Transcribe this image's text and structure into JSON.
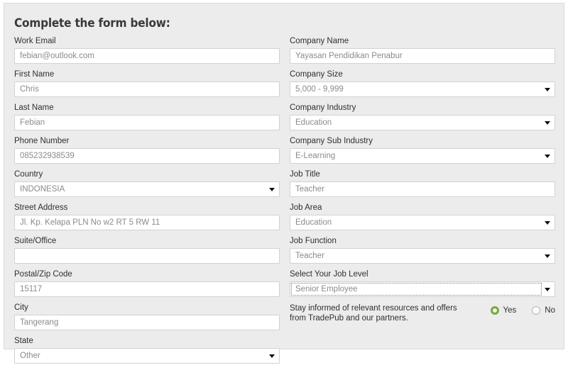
{
  "form": {
    "title": "Complete the form below:",
    "left_fields": [
      {
        "label": "Work Email",
        "value": "febian@outlook.com",
        "type": "text",
        "name": "work-email"
      },
      {
        "label": "First Name",
        "value": "Chris",
        "type": "text",
        "name": "first-name"
      },
      {
        "label": "Last Name",
        "value": "Febian",
        "type": "text",
        "name": "last-name"
      },
      {
        "label": "Phone Number",
        "value": "085232938539",
        "type": "text",
        "name": "phone-number"
      },
      {
        "label": "Country",
        "value": "INDONESIA",
        "type": "select",
        "name": "country"
      },
      {
        "label": "Street Address",
        "value": "Jl. Kp. Kelapa PLN No w2 RT 5 RW 11",
        "type": "text",
        "name": "street-address"
      },
      {
        "label": "Suite/Office",
        "value": "",
        "type": "text",
        "name": "suite-office"
      },
      {
        "label": "Postal/Zip Code",
        "value": "15117",
        "type": "text",
        "name": "postal-zip-code"
      },
      {
        "label": "City",
        "value": "Tangerang",
        "type": "text",
        "name": "city"
      },
      {
        "label": "State",
        "value": "Other",
        "type": "select",
        "name": "state"
      }
    ],
    "right_fields": [
      {
        "label": "Company Name",
        "value": "Yayasan Pendidikan Penabur",
        "type": "text",
        "name": "company-name"
      },
      {
        "label": "Company Size",
        "value": "5,000 - 9,999",
        "type": "select",
        "name": "company-size"
      },
      {
        "label": "Company Industry",
        "value": "Education",
        "type": "select",
        "name": "company-industry"
      },
      {
        "label": "Company Sub Industry",
        "value": "E-Learning",
        "type": "select",
        "name": "company-sub-industry"
      },
      {
        "label": "Job Title",
        "value": "Teacher",
        "type": "text",
        "name": "job-title"
      },
      {
        "label": "Job Area",
        "value": "Education",
        "type": "select",
        "name": "job-area"
      },
      {
        "label": "Job Function",
        "value": "Teacher",
        "type": "select",
        "name": "job-function"
      },
      {
        "label": "Select Your Job Level",
        "value": "Senior Employee",
        "type": "select",
        "name": "job-level",
        "focused": true
      }
    ],
    "consent": {
      "text": "Stay informed of relevant resources and offers from TradePub and our partners.",
      "options": [
        {
          "label": "Yes",
          "selected": true
        },
        {
          "label": "No",
          "selected": false
        }
      ]
    }
  },
  "colors": {
    "panel_background": "#ececec",
    "field_background": "#ffffff",
    "field_border": "#d2d2d2",
    "label_text": "#2f2f2f",
    "value_text": "#8b8b8b",
    "radio_accent": "#7aa83c"
  }
}
